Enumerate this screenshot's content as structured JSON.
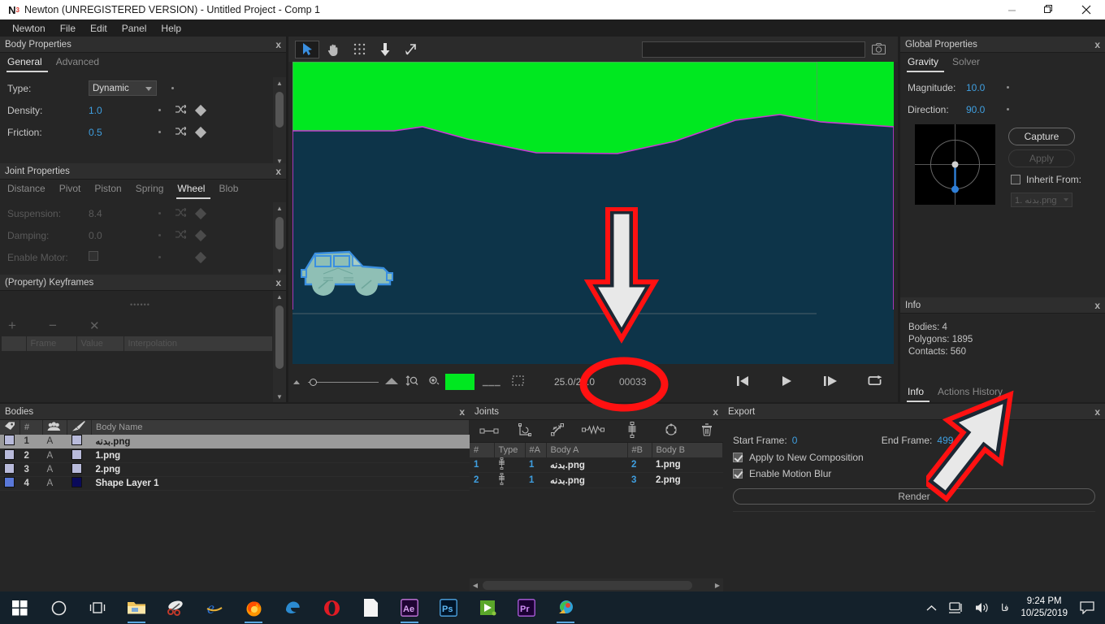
{
  "window": {
    "logo": "N",
    "logo_sup": "3",
    "title": "Newton (UNREGISTERED VERSION) - Untitled Project - Comp 1",
    "minimize": "minimize-icon",
    "maximize": "restore-icon",
    "close": "close-icon"
  },
  "menubar": {
    "items": [
      "Newton",
      "File",
      "Edit",
      "Panel",
      "Help"
    ]
  },
  "body_properties": {
    "title": "Body Properties",
    "close": "x",
    "tabs": [
      {
        "label": "General",
        "active": true
      },
      {
        "label": "Advanced",
        "active": false
      }
    ],
    "rows": [
      {
        "label": "Type:",
        "value": "Dynamic",
        "kind": "select"
      },
      {
        "label": "Density:",
        "value": "1.0",
        "kind": "number"
      },
      {
        "label": "Friction:",
        "value": "0.5",
        "kind": "number"
      }
    ]
  },
  "joint_properties": {
    "title": "Joint Properties",
    "close": "x",
    "tabs": [
      {
        "label": "Distance",
        "active": false
      },
      {
        "label": "Pivot",
        "active": false
      },
      {
        "label": "Piston",
        "active": false
      },
      {
        "label": "Spring",
        "active": false
      },
      {
        "label": "Wheel",
        "active": true
      },
      {
        "label": "Blob",
        "active": false
      }
    ],
    "rows": [
      {
        "label": "Suspension:",
        "value": "8.4",
        "kind": "number"
      },
      {
        "label": "Damping:",
        "value": "0.0",
        "kind": "number"
      },
      {
        "label": "Enable Motor:",
        "value": "",
        "kind": "checkbox"
      }
    ]
  },
  "keyframes": {
    "title": "(Property) Keyframes",
    "close": "x",
    "buttons": [
      {
        "name": "add-keyframe-button",
        "glyph": "+"
      },
      {
        "name": "remove-keyframe-button",
        "glyph": "−"
      },
      {
        "name": "clear-keyframes-button",
        "glyph": "✕"
      }
    ],
    "columns": [
      "",
      "Frame",
      "Value",
      "Interpolation"
    ],
    "rows": []
  },
  "bodies": {
    "title": "Bodies",
    "close": "x",
    "columns": [
      "tag-icon",
      "#",
      "group-icon",
      "brush-icon",
      "Body Name"
    ],
    "column_labels": {
      "index": "#",
      "name": "Body Name"
    },
    "rows": [
      {
        "color": "#b8bada",
        "index": "1",
        "group": "A",
        "brush": "#b8bada",
        "name": "بدنه.png",
        "selected": true
      },
      {
        "color": "#b8bada",
        "index": "2",
        "group": "A",
        "brush": "#b8bada",
        "name": "1.png",
        "selected": false
      },
      {
        "color": "#b8bada",
        "index": "3",
        "group": "A",
        "brush": "#b8bada",
        "name": "2.png",
        "selected": false
      },
      {
        "color": "#5a78d8",
        "index": "4",
        "group": "A",
        "brush": "#0a0a5a",
        "name": "Shape Layer 1",
        "selected": false
      }
    ]
  },
  "joints": {
    "title": "Joints",
    "close": "x",
    "toolbar": [
      "distance-joint-icon",
      "pivot-joint-icon",
      "piston-joint-icon",
      "spring-joint-icon",
      "wheel-joint-icon",
      "blob-joint-icon",
      "delete-joint-icon"
    ],
    "columns": [
      "#",
      "Type",
      "#A",
      "Body A",
      "#B",
      "Body B"
    ],
    "rows": [
      {
        "index": "1",
        "type": "wheel-joint-icon",
        "a_index": "1",
        "a_name": "بدنه.png",
        "b_index": "2",
        "b_name": "1.png"
      },
      {
        "index": "2",
        "type": "wheel-joint-icon",
        "a_index": "1",
        "a_name": "بدنه.png",
        "b_index": "3",
        "b_name": "2.png"
      }
    ]
  },
  "export": {
    "title": "Export",
    "close": "x",
    "start_frame_label": "Start Frame:",
    "start_frame_value": "0",
    "end_frame_label": "End Frame:",
    "end_frame_value": "499",
    "checkboxes": [
      {
        "label": "Apply to New Composition",
        "checked": true
      },
      {
        "label": "Enable Motion Blur",
        "checked": true
      }
    ],
    "render_button": "Render"
  },
  "global_properties": {
    "title": "Global Properties",
    "close": "x",
    "tabs": [
      {
        "label": "Gravity",
        "active": true
      },
      {
        "label": "Solver",
        "active": false
      }
    ],
    "rows": [
      {
        "label": "Magnitude:",
        "value": "10.0"
      },
      {
        "label": "Direction:",
        "value": "90.0"
      }
    ],
    "capture_button": "Capture",
    "apply_button": "Apply",
    "inherit_label": "Inherit From:",
    "inherit_checked": false,
    "inherit_value": "1. بدنه.png"
  },
  "info": {
    "title": "Info",
    "close": "x",
    "lines": [
      "Bodies: 4",
      "Polygons: 1895",
      "Contacts: 560"
    ],
    "tabs": [
      {
        "label": "Info",
        "active": true
      },
      {
        "label": "Actions History",
        "active": false
      }
    ]
  },
  "viewport": {
    "tools": [
      {
        "name": "select-tool",
        "icon": "cursor-icon",
        "active": true
      },
      {
        "name": "pan-tool",
        "icon": "hand-icon",
        "active": false
      },
      {
        "name": "grid-tool",
        "icon": "grid-dots-icon",
        "active": false
      },
      {
        "name": "gravity-tool",
        "icon": "down-arrow-icon",
        "active": false
      },
      {
        "name": "velocity-tool",
        "icon": "arrow-up-right-icon",
        "active": false
      }
    ],
    "search_value": "",
    "search_placeholder": "",
    "camera_icon": "camera-icon",
    "stage": {
      "background_color": "#00e820",
      "terrain_color": "#0d3449",
      "terrain_outline_color": "#c939d4",
      "car_body_color": "#8fbfb5",
      "car_outline_color": "#3a8fe0"
    },
    "playbar": {
      "zoom_small_icon": "zoom-out-icon",
      "zoom_slider_value": "0",
      "zoom_large_icon": "zoom-in-icon",
      "fit_icon": "fit-icon",
      "eye_icon": "visibility-icon",
      "color_swatch": "#00e820",
      "dots_icon": "dotted-line-icon",
      "marquee_icon": "selection-icon",
      "time_display": "25.0/25.0",
      "frame_display": "00033",
      "transport": [
        {
          "name": "go-to-start-button",
          "icon": "skip-start-icon"
        },
        {
          "name": "play-button",
          "icon": "play-icon"
        },
        {
          "name": "step-forward-button",
          "icon": "step-forward-icon"
        },
        {
          "name": "loop-button",
          "icon": "loop-icon"
        }
      ]
    }
  },
  "taskbar": {
    "items": [
      {
        "name": "start-button",
        "icon": "windows-logo-icon",
        "running": false
      },
      {
        "name": "cortana-button",
        "icon": "circle-icon",
        "running": false
      },
      {
        "name": "task-view-button",
        "icon": "task-view-icon",
        "running": false
      },
      {
        "name": "file-explorer-button",
        "icon": "folder-icon",
        "running": true
      },
      {
        "name": "snipping-tool-button",
        "icon": "scissors-icon",
        "running": false
      },
      {
        "name": "internet-explorer-button",
        "icon": "ie-icon",
        "running": false
      },
      {
        "name": "firefox-button",
        "icon": "firefox-icon",
        "running": true
      },
      {
        "name": "edge-button",
        "icon": "edge-icon",
        "running": false
      },
      {
        "name": "opera-button",
        "icon": "opera-icon",
        "running": false
      },
      {
        "name": "notepad-button",
        "icon": "document-icon",
        "running": false
      },
      {
        "name": "after-effects-button",
        "icon": "ae-icon",
        "running": true
      },
      {
        "name": "photoshop-button",
        "icon": "ps-icon",
        "running": false
      },
      {
        "name": "media-player-button",
        "icon": "green-play-icon",
        "running": false
      },
      {
        "name": "premiere-button",
        "icon": "pr-icon",
        "running": false
      },
      {
        "name": "winrar-button",
        "icon": "winrar-icon",
        "running": true
      }
    ],
    "tray": {
      "chevron": "show-hidden-icons-icon",
      "network": "network-icon",
      "volume": "volume-icon",
      "language": "فا",
      "time": "9:24 PM",
      "date": "10/25/2019",
      "action_center": "notifications-icon"
    }
  },
  "annotations": {
    "down_arrow": "annotation-down-arrow",
    "circle": "annotation-circle-time",
    "render_arrow": "annotation-arrow-render"
  }
}
